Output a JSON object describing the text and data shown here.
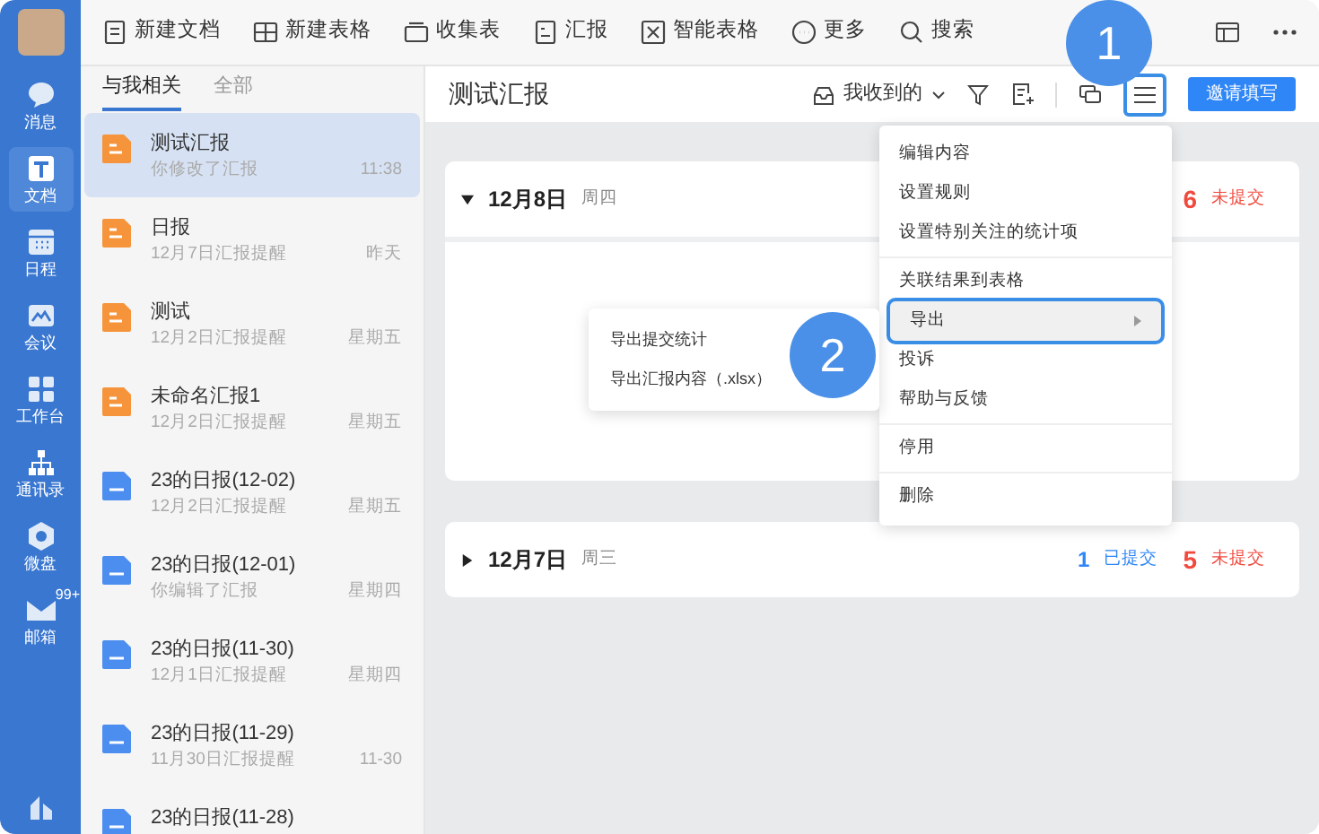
{
  "sidebar": {
    "items": [
      {
        "label": "消息",
        "selected": false
      },
      {
        "label": "文档",
        "selected": true
      },
      {
        "label": "日程",
        "selected": false
      },
      {
        "label": "会议",
        "selected": false
      },
      {
        "label": "工作台",
        "selected": false
      },
      {
        "label": "通讯录",
        "selected": false
      },
      {
        "label": "微盘",
        "selected": false
      },
      {
        "label": "邮箱",
        "selected": false,
        "badge": "99+"
      }
    ]
  },
  "toolbar": {
    "items": [
      {
        "label": "新建文档"
      },
      {
        "label": "新建表格"
      },
      {
        "label": "收集表"
      },
      {
        "label": "汇报"
      },
      {
        "label": "智能表格"
      },
      {
        "label": "更多"
      },
      {
        "label": "搜索"
      }
    ]
  },
  "list": {
    "tabs": [
      {
        "label": "与我相关",
        "selected": true
      },
      {
        "label": "全部",
        "selected": false
      }
    ],
    "items": [
      {
        "title": "测试汇报",
        "subtitle": "你修改了汇报",
        "time": "11:38",
        "kind": "report",
        "selected": true
      },
      {
        "title": "日报",
        "subtitle": "12月7日汇报提醒",
        "time": "昨天",
        "kind": "report",
        "selected": false
      },
      {
        "title": "测试",
        "subtitle": "12月2日汇报提醒",
        "time": "星期五",
        "kind": "report",
        "selected": false
      },
      {
        "title": "未命名汇报1",
        "subtitle": "12月2日汇报提醒",
        "time": "星期五",
        "kind": "report",
        "selected": false
      },
      {
        "title": "23的日报(12-02)",
        "subtitle": "12月2日汇报提醒",
        "time": "星期五",
        "kind": "doc",
        "selected": false
      },
      {
        "title": "23的日报(12-01)",
        "subtitle": "你编辑了汇报",
        "time": "星期四",
        "kind": "doc",
        "selected": false
      },
      {
        "title": "23的日报(11-30)",
        "subtitle": "12月1日汇报提醒",
        "time": "星期四",
        "kind": "doc",
        "selected": false
      },
      {
        "title": "23的日报(11-29)",
        "subtitle": "11月30日汇报提醒",
        "time": "11-30",
        "kind": "doc",
        "selected": false
      },
      {
        "title": "23的日报(11-28)",
        "kind": "doc",
        "selected": false
      }
    ]
  },
  "header": {
    "title": "测试汇报",
    "filter": "我收到的",
    "invite_button": "邀请填写"
  },
  "days": [
    {
      "date": "12月8日",
      "weekday": "周四",
      "expanded": true,
      "not_submitted_count": "6",
      "not_submitted_label": "未提交"
    },
    {
      "date": "12月7日",
      "weekday": "周三",
      "expanded": false,
      "submitted_count": "1",
      "submitted_label": "已提交",
      "not_submitted_count": "5",
      "not_submitted_label": "未提交"
    }
  ],
  "menu": {
    "groups": [
      [
        {
          "label": "编辑内容",
          "selected": false
        },
        {
          "label": "设置规则",
          "selected": false
        },
        {
          "label": "设置特别关注的统计项",
          "selected": false
        }
      ],
      [
        {
          "label": "关联结果到表格",
          "selected": false
        },
        {
          "label": "导出",
          "selected": true,
          "submenu": true
        },
        {
          "label": "投诉",
          "selected": false
        },
        {
          "label": "帮助与反馈",
          "selected": false
        }
      ],
      [
        {
          "label": "停用",
          "selected": false
        }
      ],
      [
        {
          "label": "删除",
          "selected": false
        }
      ]
    ]
  },
  "submenu": {
    "items": [
      "导出提交统计",
      "导出汇报内容（.xlsx）"
    ]
  },
  "step_markers": [
    {
      "label": "1"
    },
    {
      "label": "2"
    }
  ]
}
